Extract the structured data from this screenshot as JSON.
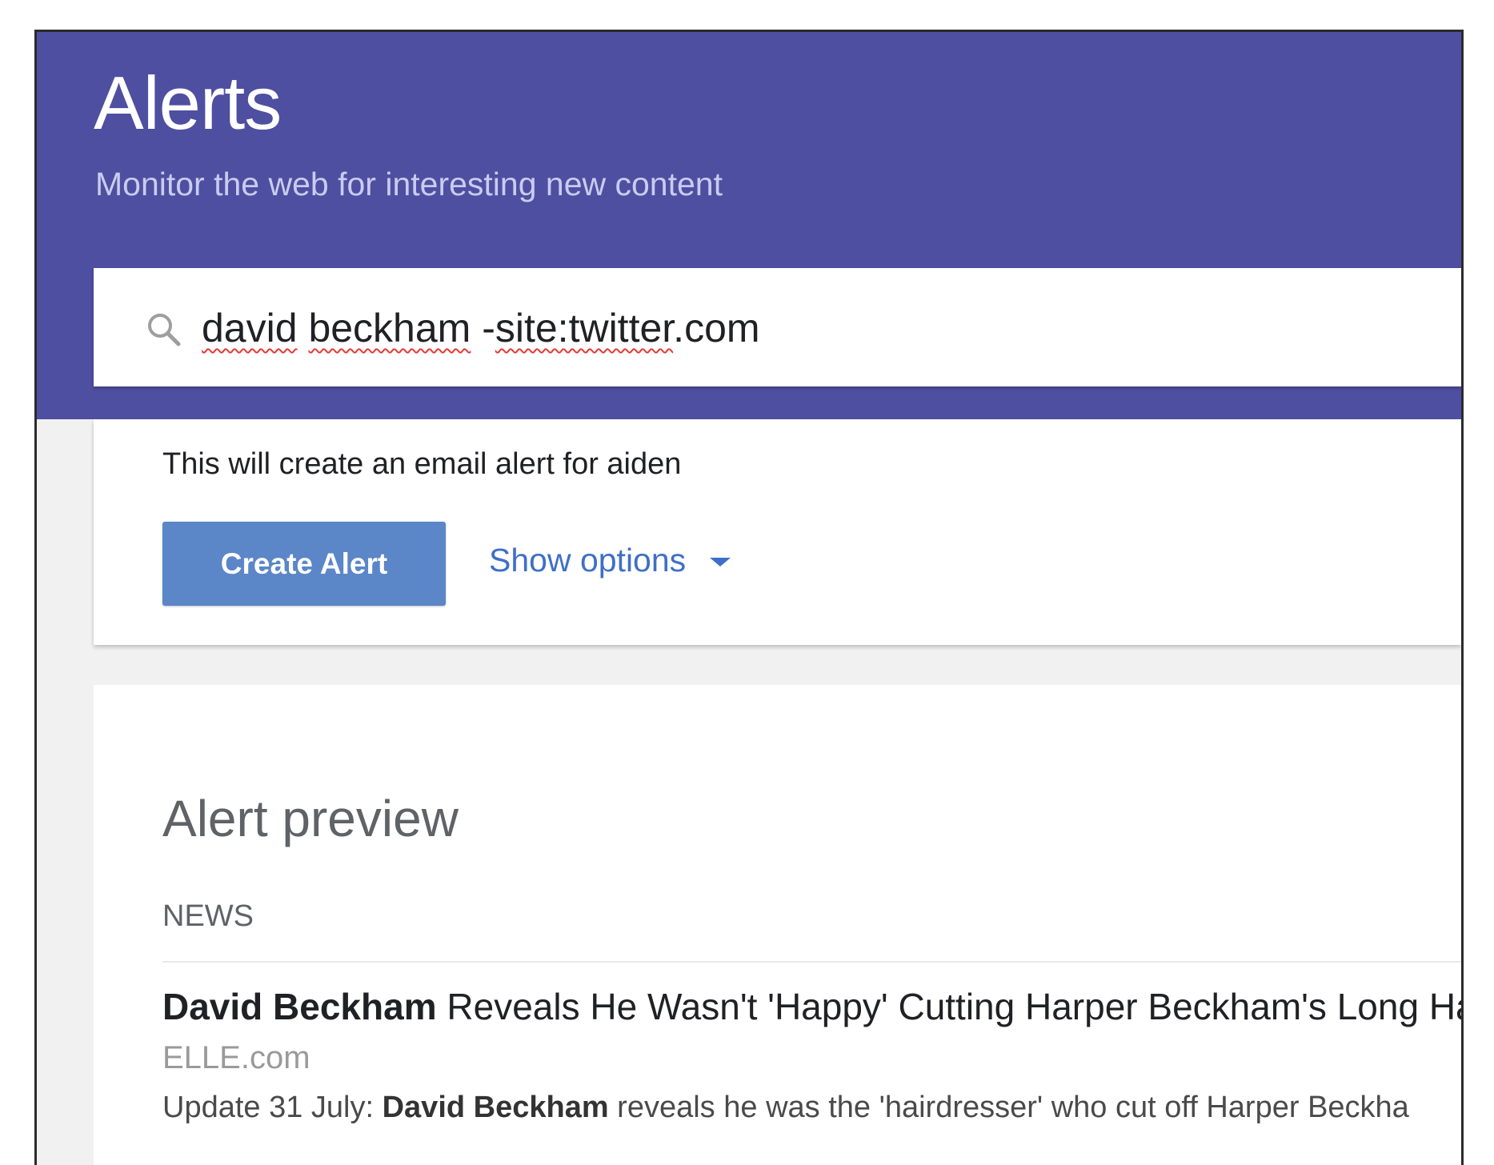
{
  "header": {
    "title": "Alerts",
    "subtitle": "Monitor the web for interesting new content"
  },
  "search": {
    "query_parts": [
      "david",
      " ",
      "beckham",
      " -",
      "site:twitter",
      ".com"
    ],
    "icon": "search-icon"
  },
  "create_card": {
    "note": "This will create an email alert for aiden",
    "create_button": "Create Alert",
    "show_options": "Show options"
  },
  "preview": {
    "title": "Alert preview",
    "section": "NEWS",
    "items": [
      {
        "headline_bold": "David Beckham",
        "headline_rest": " Reveals He Wasn't 'Happy' Cutting Harper Beckham's Long Ha",
        "source": "ELLE.com",
        "snippet_prefix": "Update 31 July: ",
        "snippet_bold": "David Beckham",
        "snippet_rest": " reveals he was the 'hairdresser' who cut off Harper Beckha"
      }
    ]
  },
  "colors": {
    "header_bg": "#4e4fa0",
    "button_bg": "#5b86c8",
    "link": "#3f6fc8"
  }
}
